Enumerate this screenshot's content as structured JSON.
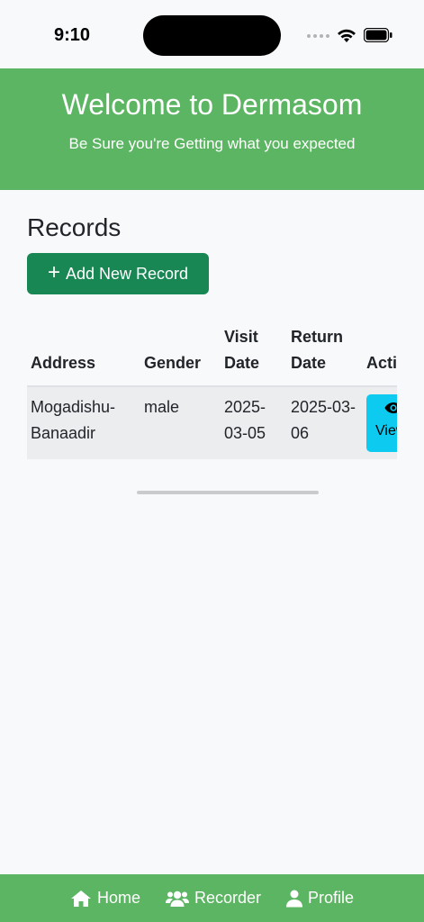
{
  "status": {
    "time": "9:10"
  },
  "header": {
    "title": "Welcome to Dermasom",
    "subtitle": "Be Sure you're Getting what you expected"
  },
  "records": {
    "title": "Records",
    "add_button_label": "Add New Record",
    "columns": [
      "Address",
      "Gender",
      "Visit Date",
      "Return Date",
      "Actions"
    ],
    "rows": [
      {
        "address": "Mogadishu-Banaadir",
        "gender": "male",
        "visit_date": "2025-03-05",
        "return_date": "2025-03-06",
        "action_label": "View"
      }
    ]
  },
  "nav": {
    "home": "Home",
    "recorder": "Recorder",
    "profile": "Profile"
  },
  "icons": {
    "add": "plus-icon",
    "view": "eye-icon",
    "home": "home-icon",
    "recorder": "users-icon",
    "profile": "user-icon"
  },
  "colors": {
    "header_bg": "#5cb562",
    "add_button": "#198754",
    "view_button": "#0dcaf0",
    "nav_bg": "#5cb562"
  }
}
